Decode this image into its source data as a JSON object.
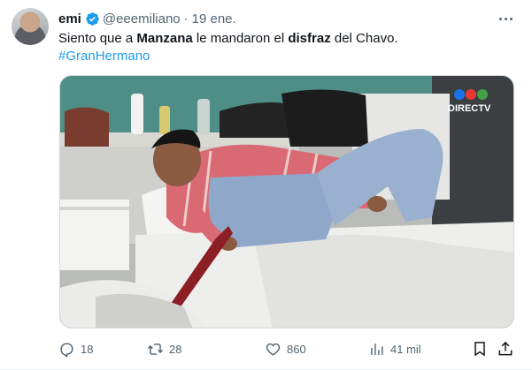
{
  "tweet": {
    "author": {
      "display_name": "emi",
      "handle": "@eeemiliano",
      "verified": true
    },
    "date": "19 ene.",
    "separator": "·",
    "text_parts": [
      "Siento que a ",
      "Manzana",
      " le mandaron el ",
      "disfraz",
      " del Chavo."
    ],
    "hashtag": "#GranHermano",
    "media": {
      "watermark": "DIRECTV"
    },
    "stats": {
      "replies": "18",
      "retweets": "28",
      "likes": "860",
      "views": "41 mil"
    }
  },
  "colors": {
    "accent": "#1d9bf0",
    "muted": "#536471",
    "text": "#0f1419"
  },
  "icons": {
    "more": "more-horizontal-icon",
    "reply": "reply-icon",
    "retweet": "retweet-icon",
    "like": "heart-icon",
    "views": "views-chart-icon",
    "bookmark": "bookmark-icon",
    "share": "share-icon",
    "verified": "verified-badge-icon"
  }
}
